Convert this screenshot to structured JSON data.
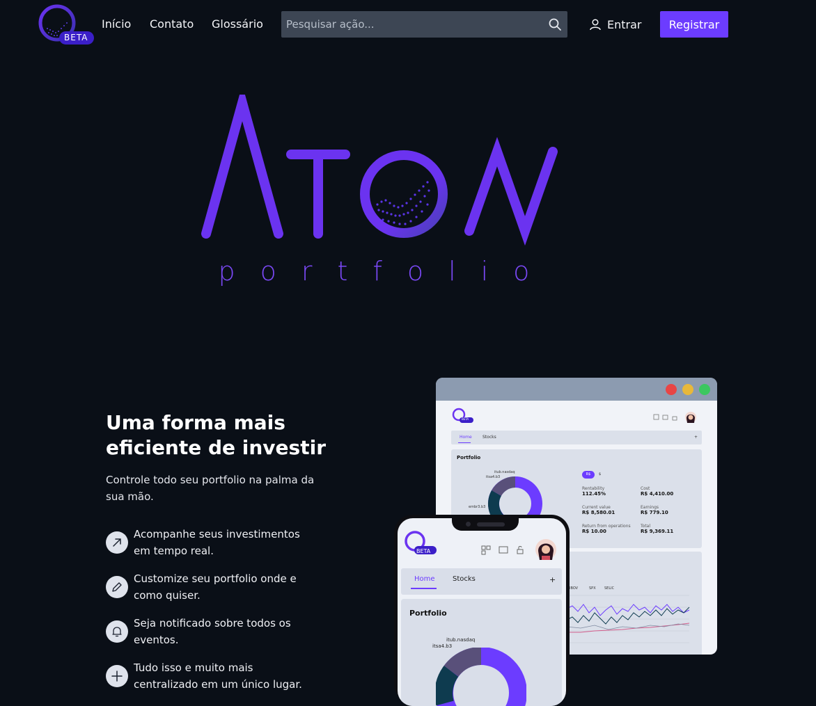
{
  "nav": {
    "badge": "BETA",
    "links": [
      "Início",
      "Contato",
      "Glossário"
    ],
    "search_placeholder": "Pesquisar ação...",
    "login_label": "Entrar",
    "register_label": "Registrar"
  },
  "hero": {
    "word": "ATOM",
    "sub": "portfolio"
  },
  "intro": {
    "headline": "Uma forma mais eficiente de investir",
    "subline": "Controle todo seu portfolio na palma da sua mão.",
    "features": [
      {
        "icon": "arrow-up-right-icon",
        "text": "Acompanhe seus investimentos em tempo real."
      },
      {
        "icon": "pencil-icon",
        "text": "Customize seu portfolio onde e como quiser."
      },
      {
        "icon": "bell-icon",
        "text": "Seja notificado sobre todos os eventos."
      },
      {
        "icon": "plus-icon",
        "text": "Tudo isso e muito mais centralizado em um único lugar."
      }
    ]
  },
  "mockup": {
    "badge": "BETA",
    "tabs": [
      "Home",
      "Stocks"
    ],
    "add_tab": "+",
    "card_title": "Portfolio",
    "currency_toggle": [
      "R$",
      "$"
    ],
    "donut_labels": [
      "itub.nasdaq",
      "itsa4.b3",
      "embr3.b3"
    ],
    "stats": [
      {
        "label": "Rentability",
        "value": "112.45%"
      },
      {
        "label": "Cost",
        "value": "R$ 4,410.00"
      },
      {
        "label": "Current value",
        "value": "R$ 8,580.01"
      },
      {
        "label": "Earnings",
        "value": "R$ 779.10"
      },
      {
        "label": "Return from operations",
        "value": "R$ 10.00"
      },
      {
        "label": "Total",
        "value": "R$ 9,369.11"
      }
    ],
    "legend": [
      "IBOV",
      "SPX",
      "SELIC"
    ],
    "phone_donut_labels": [
      "itub.nasdaq",
      "itsa4.b3"
    ]
  },
  "colors": {
    "background": "#0a0f17",
    "accent": "#6c3cff",
    "search_bg": "#3d4654",
    "window_red": "#e84545",
    "window_yellow": "#e8b83a",
    "window_green": "#3cc760"
  }
}
